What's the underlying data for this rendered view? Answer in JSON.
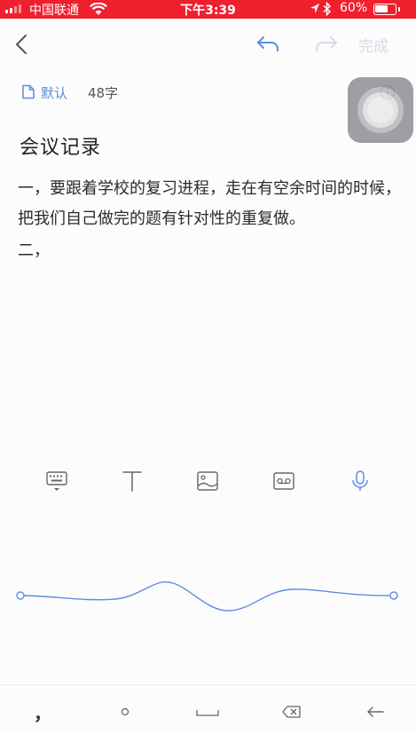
{
  "status_bar": {
    "carrier": "中国联通",
    "time": "下午3:39",
    "battery": "60%",
    "battery_level": 0.6
  },
  "nav": {
    "done_label": "完成"
  },
  "meta": {
    "folder_label": "默认",
    "word_count": "48字"
  },
  "note": {
    "title": "会议记录",
    "paragraph1": "一，要跟着学校的复习进程，走在有空余时间的时候，把我们自己做完的题有针对性的重复做。",
    "paragraph2": "二，"
  },
  "toolbar": {
    "items": [
      "keyboard-icon",
      "text-format-icon",
      "image-icon",
      "tape-icon",
      "microphone-icon"
    ]
  },
  "keyboard_row": {
    "keys": [
      "comma-key",
      "dot-key",
      "space-key",
      "delete-key",
      "return-key"
    ],
    "comma": "，"
  },
  "colors": {
    "status_bar": "#f01f2e",
    "accent": "#5d8ce0",
    "disabled": "#d4dbe6"
  }
}
